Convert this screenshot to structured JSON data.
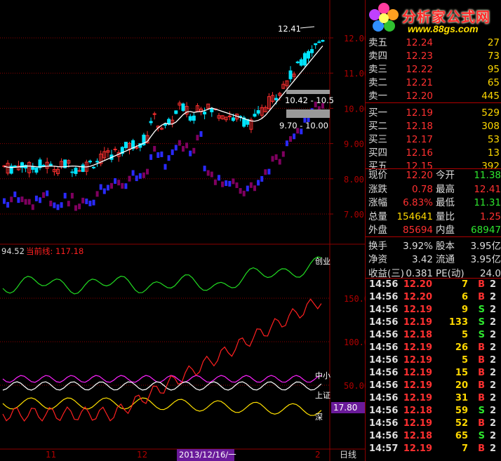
{
  "axis": {
    "price_ticks": [
      "12.00",
      "11.00",
      "10.00",
      "9.00",
      "8.00",
      "7.00"
    ],
    "indicator_ticks": [
      "150.0",
      "100.0",
      "50.00"
    ],
    "date_ticks": [
      "11",
      "12",
      "2"
    ],
    "current_date": "2013/12/16/一",
    "period": "日线",
    "indicator_current_box": "17.80"
  },
  "annotations": {
    "high_label": "12.41",
    "resistance_band": "10.42 - 10.5",
    "support_band": "9.70 - 10.00",
    "indicator_header_value": "94.52",
    "indicator_header_label": "当前线: 117.18",
    "line_zhongxiao": "中小",
    "line_shangzheng": "上证",
    "line_shen": "深",
    "line_chuangye": "创业"
  },
  "logo": {
    "text": "分析家公式网",
    "url": "www.88gs.com"
  },
  "orderbook": {
    "asks": [
      {
        "label": "卖五",
        "price": "12.24",
        "vol": "27"
      },
      {
        "label": "卖四",
        "price": "12.23",
        "vol": "73"
      },
      {
        "label": "卖三",
        "price": "12.22",
        "vol": "95"
      },
      {
        "label": "卖二",
        "price": "12.21",
        "vol": "65"
      },
      {
        "label": "卖一",
        "price": "12.20",
        "vol": "445"
      }
    ],
    "bids": [
      {
        "label": "买一",
        "price": "12.19",
        "vol": "529"
      },
      {
        "label": "买二",
        "price": "12.18",
        "vol": "308"
      },
      {
        "label": "买三",
        "price": "12.17",
        "vol": "53"
      },
      {
        "label": "买四",
        "price": "12.16",
        "vol": "13"
      },
      {
        "label": "买五",
        "price": "12.15",
        "vol": "392"
      }
    ]
  },
  "quote": {
    "xianjia_l": "现价",
    "xianjia": "12.20",
    "jinkai_l": "今开",
    "jinkai": "11.38",
    "zhangdie_l": "涨跌",
    "zhangdie": "0.78",
    "zuigao_l": "最高",
    "zuigao": "12.41",
    "zhangfu_l": "涨幅",
    "zhangfu": "6.83%",
    "zuidi_l": "最低",
    "zuidi": "11.31",
    "zongliang_l": "总量",
    "zongliang": "154641",
    "liangbi_l": "量比",
    "liangbi": "1.25",
    "waipan_l": "外盘",
    "waipan": "85694",
    "neipan_l": "内盘",
    "neipan": "68947",
    "huanshou_l": "换手",
    "huanshou": "3.92%",
    "guben_l": "股本",
    "guben": "3.95亿",
    "jingzi_l": "净资",
    "jingzi": "3.42",
    "liutong_l": "流通",
    "liutong": "3.95亿",
    "shouyi_l": "收益(三)",
    "shouyi": "0.381",
    "pe_l": "PE(动)",
    "pe": "24.0"
  },
  "trades": [
    {
      "time": "14:56",
      "price": "12.20",
      "vol": "7",
      "bs": "B",
      "pc": "r"
    },
    {
      "time": "14:56",
      "price": "12.20",
      "vol": "6",
      "bs": "B",
      "pc": "r"
    },
    {
      "time": "14:56",
      "price": "12.19",
      "vol": "9",
      "bs": "S",
      "pc": "r"
    },
    {
      "time": "14:56",
      "price": "12.19",
      "vol": "133",
      "bs": "S",
      "pc": "r"
    },
    {
      "time": "14:56",
      "price": "12.18",
      "vol": "5",
      "bs": "S",
      "pc": "r"
    },
    {
      "time": "14:56",
      "price": "12.19",
      "vol": "26",
      "bs": "B",
      "pc": "r"
    },
    {
      "time": "14:56",
      "price": "12.19",
      "vol": "5",
      "bs": "B",
      "pc": "r"
    },
    {
      "time": "14:56",
      "price": "12.19",
      "vol": "15",
      "bs": "B",
      "pc": "r"
    },
    {
      "time": "14:56",
      "price": "12.19",
      "vol": "20",
      "bs": "B",
      "pc": "r"
    },
    {
      "time": "14:56",
      "price": "12.19",
      "vol": "31",
      "bs": "B",
      "pc": "r"
    },
    {
      "time": "14:56",
      "price": "12.18",
      "vol": "59",
      "bs": "S",
      "pc": "r"
    },
    {
      "time": "14:56",
      "price": "12.19",
      "vol": "52",
      "bs": "B",
      "pc": "r"
    },
    {
      "time": "14:56",
      "price": "12.18",
      "vol": "65",
      "bs": "S",
      "pc": "r"
    },
    {
      "time": "14:57",
      "price": "12.19",
      "vol": "7",
      "bs": "B",
      "pc": "r"
    }
  ],
  "colors": {
    "grid": "#8b0000",
    "up": "#ff3030",
    "down": "#00e5ff",
    "dn2": "#2a2aff",
    "ma": "#ffffff",
    "green": "#22dd22",
    "purple": "#ff22ff",
    "yellow": "#ffe000",
    "red": "#ff2020"
  }
}
